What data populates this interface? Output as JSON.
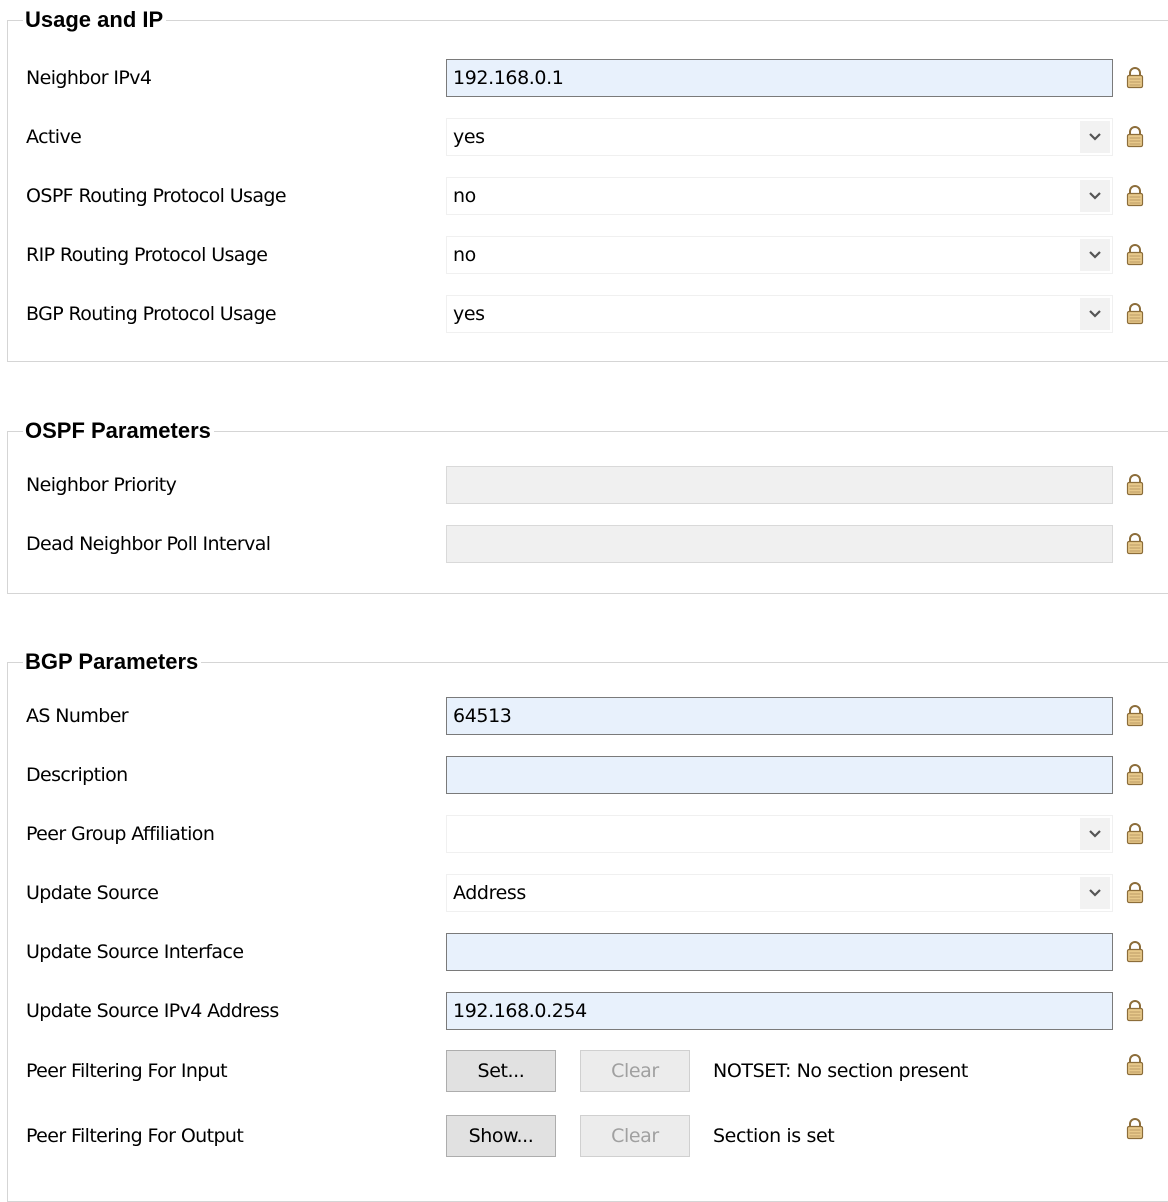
{
  "usage_ip": {
    "title": "Usage and IP",
    "neighbor_ipv4": {
      "label": "Neighbor IPv4",
      "value": "192.168.0.1"
    },
    "active": {
      "label": "Active",
      "value": "yes"
    },
    "ospf_usage": {
      "label": "OSPF Routing Protocol Usage",
      "value": "no"
    },
    "rip_usage": {
      "label": "RIP Routing Protocol Usage",
      "value": "no"
    },
    "bgp_usage": {
      "label": "BGP Routing Protocol Usage",
      "value": "yes"
    }
  },
  "ospf": {
    "title": "OSPF Parameters",
    "neighbor_priority": {
      "label": "Neighbor Priority",
      "value": ""
    },
    "dead_poll_interval": {
      "label": "Dead Neighbor Poll Interval",
      "value": ""
    }
  },
  "bgp": {
    "title": "BGP Parameters",
    "as_number": {
      "label": "AS Number",
      "value": "64513"
    },
    "description": {
      "label": "Description",
      "value": ""
    },
    "peer_group": {
      "label": "Peer Group Affiliation",
      "value": ""
    },
    "update_source": {
      "label": "Update Source",
      "value": "Address"
    },
    "update_source_interface": {
      "label": "Update Source Interface",
      "value": ""
    },
    "update_source_ipv4": {
      "label": "Update Source IPv4 Address",
      "value": "192.168.0.254"
    },
    "filter_input": {
      "label": "Peer Filtering For Input",
      "primary_button": "Set...",
      "clear_button": "Clear",
      "status": "NOTSET: No section present"
    },
    "filter_output": {
      "label": "Peer Filtering For Output",
      "primary_button": "Show...",
      "clear_button": "Clear",
      "status": "Section is set"
    }
  },
  "icons": {
    "lock": "lock-icon",
    "dropdown": "chevron-down-icon"
  },
  "colors": {
    "input_background": "#e8f1fc",
    "input_border": "#7a7a7a",
    "disabled_background": "#f0f0f0",
    "group_border": "#d5d5d5",
    "lock_fill": "#e8c98b",
    "lock_stroke": "#8c6d3a"
  }
}
